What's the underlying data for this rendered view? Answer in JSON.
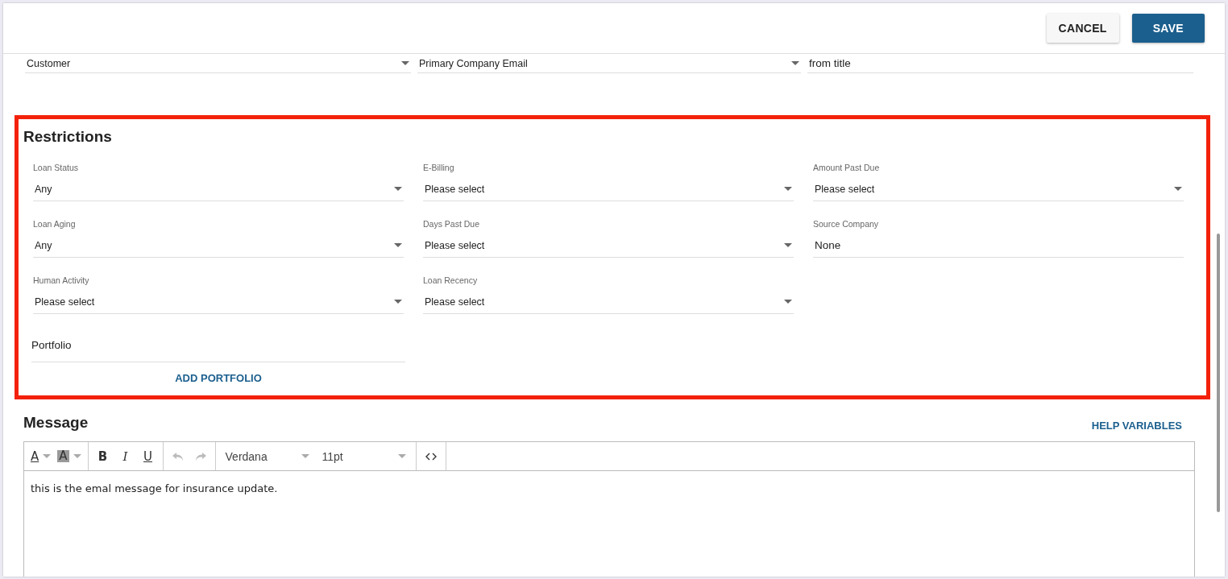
{
  "header": {
    "buttons": [
      {
        "label": "CANCEL",
        "kind": "secondary"
      },
      {
        "label": "SAVE",
        "kind": "primary"
      }
    ]
  },
  "top_fields": [
    {
      "kind": "select",
      "value": "Customer"
    },
    {
      "kind": "select",
      "value": "Primary Company Email"
    },
    {
      "kind": "text",
      "value": "from title"
    }
  ],
  "restrictions": {
    "title": "Restrictions",
    "fields": [
      {
        "label": "Loan Status",
        "kind": "select",
        "value": "Any"
      },
      {
        "label": "E-Billing",
        "kind": "select",
        "value": "Please select"
      },
      {
        "label": "Amount Past Due",
        "kind": "select",
        "value": "Please select"
      },
      {
        "label": "Loan Aging",
        "kind": "select",
        "value": "Any"
      },
      {
        "label": "Days Past Due",
        "kind": "select",
        "value": "Please select"
      },
      {
        "label": "Source Company",
        "kind": "text",
        "value": "None"
      },
      {
        "label": "Human Activity",
        "kind": "select",
        "value": "Please select"
      },
      {
        "label": "Loan Recency",
        "kind": "select",
        "value": "Please select"
      }
    ],
    "portfolio": {
      "placeholder": "Portfolio"
    },
    "add_button": "ADD PORTFOLIO"
  },
  "message": {
    "title": "Message",
    "help_link": "HELP VARIABLES",
    "toolbar": [
      [
        {
          "kind": "textcolor",
          "glyph": "A"
        },
        {
          "kind": "bgcolor",
          "glyph": "A"
        }
      ],
      [
        {
          "kind": "bold",
          "glyph": "B"
        },
        {
          "kind": "italic",
          "glyph": "I"
        },
        {
          "kind": "underline",
          "glyph": "U"
        }
      ],
      [
        {
          "kind": "undo",
          "disabled": true
        },
        {
          "kind": "redo",
          "disabled": true
        }
      ],
      [
        {
          "kind": "font",
          "value": "Verdana"
        },
        {
          "kind": "size",
          "value": "11pt"
        }
      ],
      [
        {
          "kind": "code"
        }
      ]
    ],
    "body": "this is the emal message for insurance update."
  }
}
